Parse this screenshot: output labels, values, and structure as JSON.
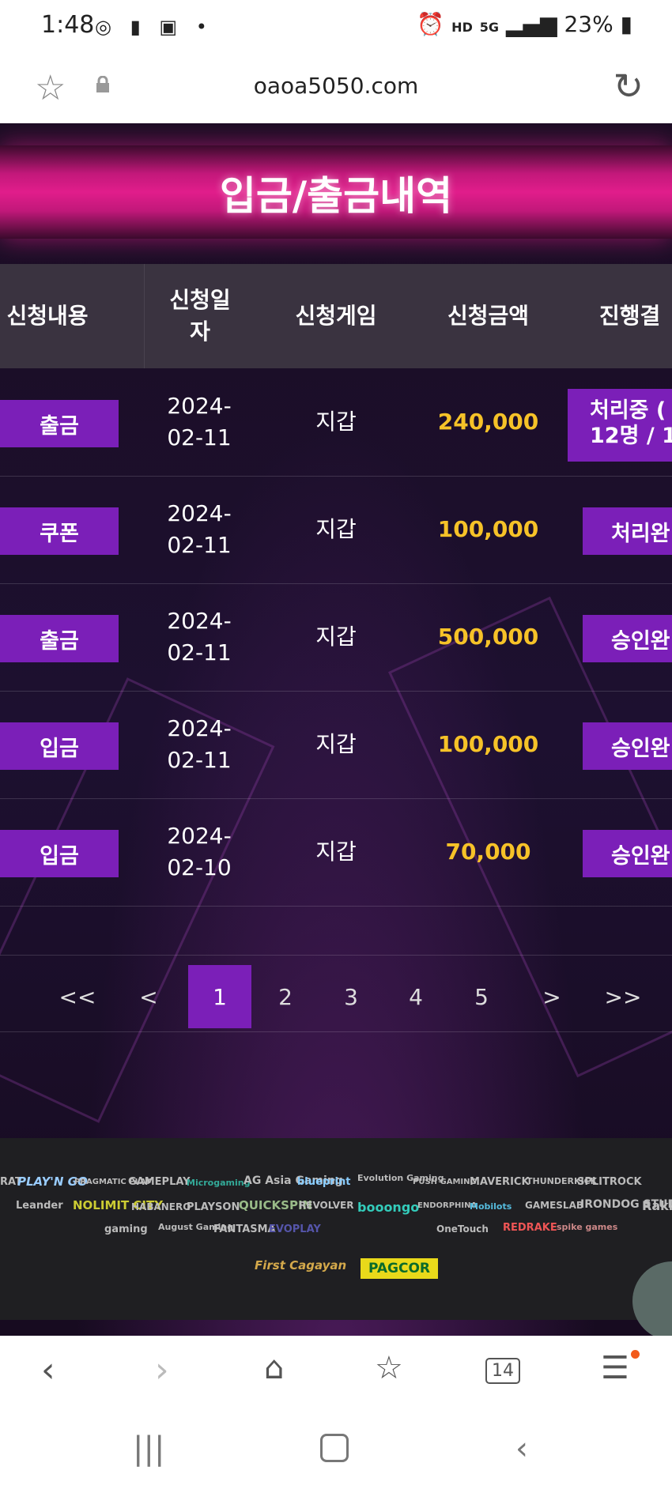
{
  "status_bar": {
    "time": "1:48",
    "hd": "HD",
    "network": "5G",
    "battery": "23%"
  },
  "browser": {
    "url": "oaoa5050.com",
    "tab_count": "14"
  },
  "page": {
    "title": "입금/출금내역"
  },
  "table": {
    "headers": [
      "신청내용",
      "신청일\n자",
      "신청게임",
      "신청금액",
      "진행결"
    ],
    "rows": [
      {
        "type": "출금",
        "date": "2024-\n02-11",
        "game": "지갑",
        "amount": "240,000",
        "status": "처리중 (\n12명 / 1"
      },
      {
        "type": "쿠폰",
        "date": "2024-\n02-11",
        "game": "지갑",
        "amount": "100,000",
        "status": "처리완"
      },
      {
        "type": "출금",
        "date": "2024-\n02-11",
        "game": "지갑",
        "amount": "500,000",
        "status": "승인완"
      },
      {
        "type": "입금",
        "date": "2024-\n02-11",
        "game": "지갑",
        "amount": "100,000",
        "status": "승인완"
      },
      {
        "type": "입금",
        "date": "2024-\n02-10",
        "game": "지갑",
        "amount": "70,000",
        "status": "승인완"
      }
    ]
  },
  "pagination": {
    "first": "<<",
    "prev": "<",
    "pages": [
      "1",
      "2",
      "3",
      "4",
      "5"
    ],
    "next": ">",
    "last": ">>",
    "current": "1"
  },
  "footer": {
    "logos_row1": [
      "RAT",
      "PLAY'N GO",
      "PRAGMATIC PLAY",
      "GAMEPLAY",
      "Microgaming",
      "AG Asia Gaming",
      "blueprint",
      "Evolution Gaming",
      "PUSH GAMING",
      "MAVERICK",
      "THUNDERKICK",
      "SPLITROCK"
    ],
    "logos_row2": [
      "Leander",
      "NOLIMIT CITY",
      "HABANERO",
      "PLAYSON",
      "QUICKSPIN",
      "REVOLVER",
      "booongo",
      "ENDORPHINA",
      "Mobilots",
      "GAMESLAB",
      "IRONDOG STUDIO",
      "Rakk"
    ],
    "logos_row3": [
      "gaming",
      "August Gaming",
      "FANTASMA",
      "EVOPLAY",
      "",
      "",
      "OneTouch",
      "REDRAKE",
      "spike games"
    ],
    "badges": [
      "First Cagayan",
      "PAGCOR"
    ]
  },
  "colors": {
    "accent": "#7b1fb8",
    "amount": "#f6c228",
    "banner": "#e11d8b"
  }
}
